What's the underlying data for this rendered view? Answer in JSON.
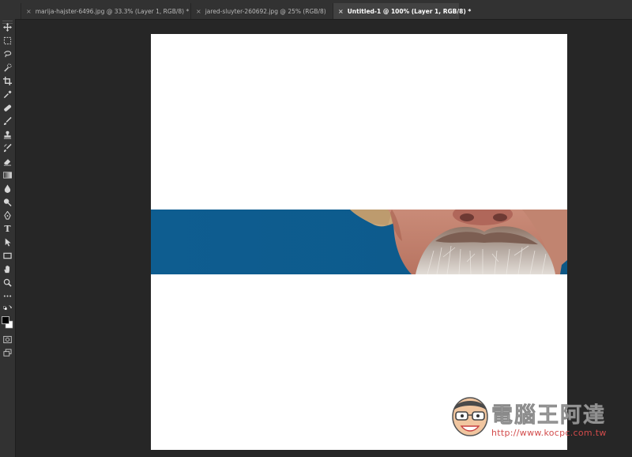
{
  "tabs": [
    {
      "label": "marija-hajster-6496.jpg @ 33.3% (Layer 1, RGB/8) *",
      "active": false
    },
    {
      "label": "jared-sluyter-260692.jpg @ 25% (RGB/8)",
      "active": false
    },
    {
      "label": "Untitled-1 @ 100% (Layer 1, RGB/8) *",
      "active": true
    }
  ],
  "tab_close_glyph": "×",
  "tools": [
    "move-tool-icon",
    "marquee-tool-icon",
    "lasso-tool-icon",
    "quick-selection-tool-icon",
    "crop-tool-icon",
    "eyedropper-tool-icon",
    "healing-brush-tool-icon",
    "brush-tool-icon",
    "clone-stamp-tool-icon",
    "history-brush-tool-icon",
    "eraser-tool-icon",
    "gradient-tool-icon",
    "blur-tool-icon",
    "dodge-tool-icon",
    "pen-tool-icon",
    "type-tool-icon",
    "path-selection-tool-icon",
    "rectangle-tool-icon",
    "hand-tool-icon",
    "zoom-tool-icon",
    "edit-toolbar-icon",
    "default-colors-icon",
    "foreground-background-color-icon",
    "quick-mask-icon",
    "screen-mode-icon"
  ],
  "type_tool_glyph": "T",
  "colors": {
    "ui_panel": "#323232",
    "workspace": "#262626",
    "canvas": "#ffffff",
    "photo_sky": "#0e5d90"
  },
  "watermark": {
    "title": "電腦王阿達",
    "url": "http://www.kocpc.com.tw"
  }
}
